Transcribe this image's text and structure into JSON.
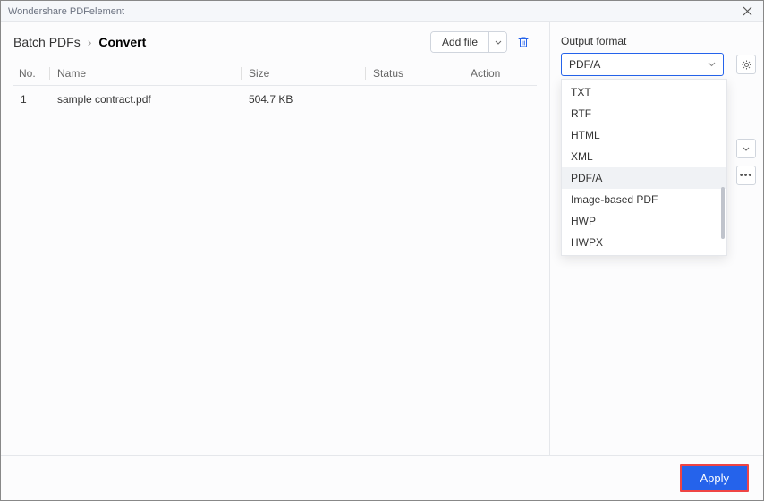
{
  "titlebar": {
    "title": "Wondershare PDFelement"
  },
  "breadcrumb": {
    "root": "Batch PDFs",
    "current": "Convert"
  },
  "toolbar": {
    "addfile": "Add file"
  },
  "table": {
    "headers": {
      "no": "No.",
      "name": "Name",
      "size": "Size",
      "status": "Status",
      "action": "Action"
    },
    "rows": [
      {
        "no": "1",
        "name": "sample contract.pdf",
        "size": "504.7 KB",
        "status": "",
        "action": ""
      }
    ]
  },
  "output": {
    "label": "Output format",
    "selected": "PDF/A",
    "options": [
      "TXT",
      "RTF",
      "HTML",
      "XML",
      "PDF/A",
      "Image-based PDF",
      "HWP",
      "HWPX"
    ],
    "highlighted_index": 4
  },
  "footer": {
    "apply": "Apply"
  }
}
